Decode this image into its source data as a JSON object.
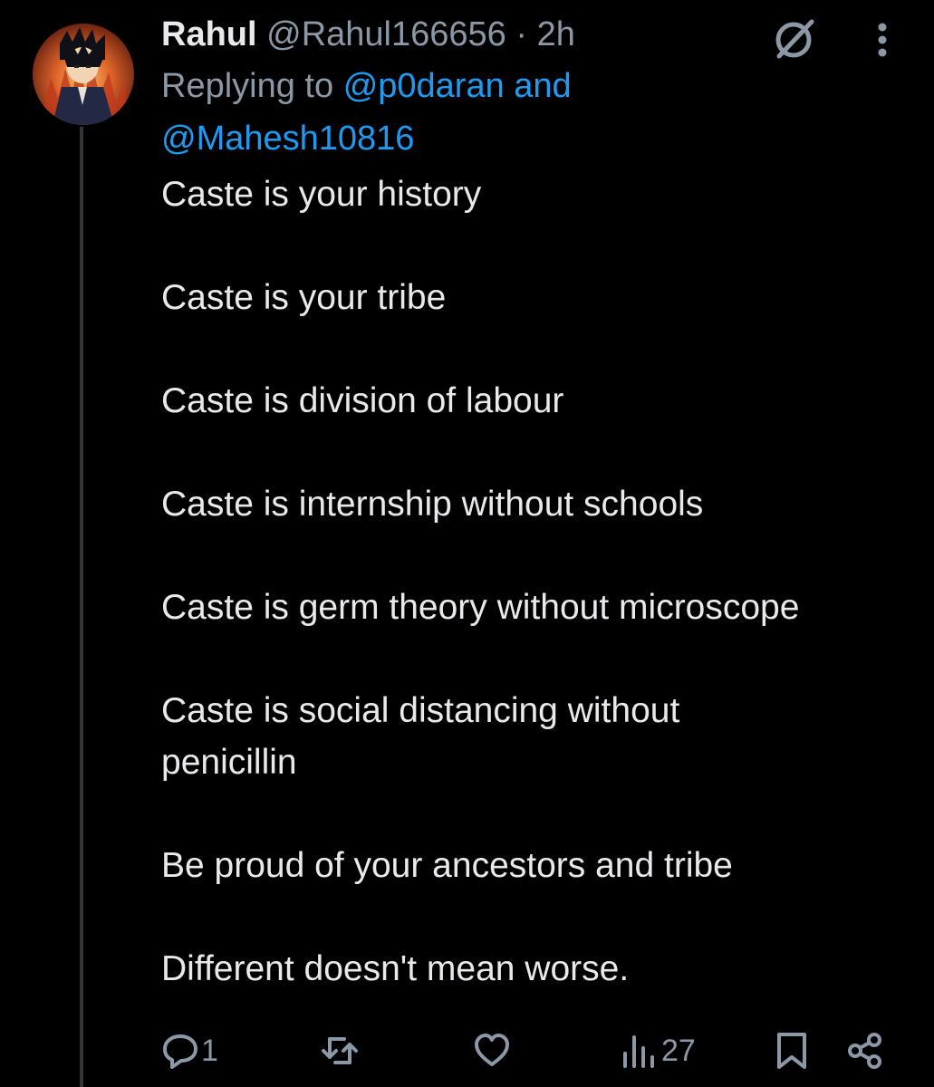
{
  "tweet": {
    "author_name": "Rahul",
    "author_handle": "@Rahul166656",
    "separator": "·",
    "time": "2h",
    "reply_prefix": "Replying to",
    "mention_1": "@p0daran and",
    "mention_2": "@Mahesh10816",
    "lines": [
      "Caste is your history",
      "Caste is your tribe",
      "Caste is division of labour",
      "Caste is internship without schools",
      "Caste is germ theory without microscope",
      "Caste is social distancing without penicillin",
      "Be proud of your ancestors and tribe",
      "Different doesn't mean worse."
    ]
  },
  "actions": {
    "reply_count": "1",
    "retweet_count": "",
    "like_count": "",
    "views_count": "27"
  },
  "icons": {
    "grok": "grok-icon",
    "more": "more-vertical-icon",
    "reply": "reply-icon",
    "retweet": "retweet-icon",
    "like": "heart-icon",
    "views": "views-icon",
    "bookmark": "bookmark-icon",
    "share": "share-icon"
  },
  "colors": {
    "background": "#000000",
    "text": "#e7e9ea",
    "secondary": "#8b98a5",
    "link": "#1d9bf0"
  }
}
